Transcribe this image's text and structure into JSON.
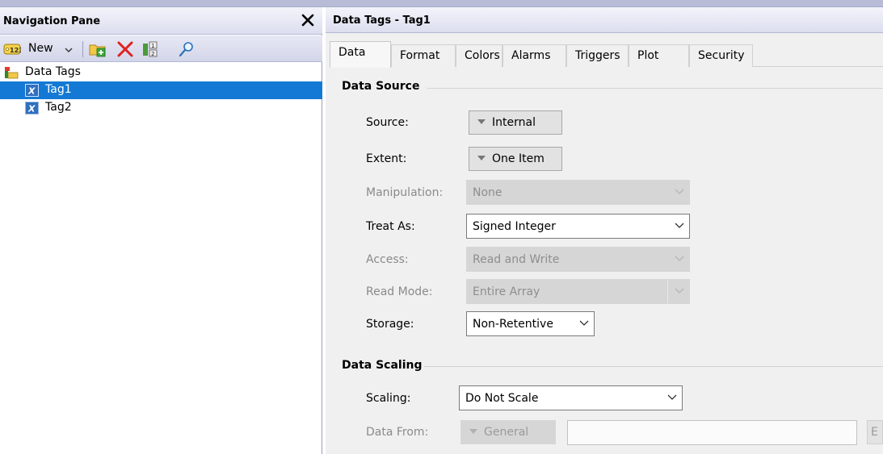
{
  "nav_pane": {
    "title": "Navigation Pane",
    "toolbar": {
      "new_label": "New",
      "icons": [
        "tag-123-icon",
        "dropdown-arrow-icon",
        "add-folder-icon",
        "delete-icon",
        "sort-icon",
        "search-icon"
      ]
    },
    "tree": {
      "root_label": "Data Tags",
      "items": [
        {
          "label": "Tag1",
          "selected": true
        },
        {
          "label": "Tag2",
          "selected": false
        }
      ]
    }
  },
  "panel": {
    "title": "Data Tags - Tag1",
    "tabs": [
      "Data",
      "Format",
      "Colors",
      "Alarms",
      "Triggers",
      "Plot",
      "Security"
    ],
    "active_tab": "Data",
    "data_source": {
      "section_title": "Data Source",
      "source": {
        "label": "Source:",
        "value": "Internal"
      },
      "extent": {
        "label": "Extent:",
        "value": "One Item"
      },
      "manipulation": {
        "label": "Manipulation:",
        "value": "None",
        "enabled": false
      },
      "treat_as": {
        "label": "Treat As:",
        "value": "Signed Integer"
      },
      "access": {
        "label": "Access:",
        "value": "Read and Write",
        "enabled": false
      },
      "read_mode": {
        "label": "Read Mode:",
        "value": "Entire Array",
        "enabled": false
      },
      "storage": {
        "label": "Storage:",
        "value": "Non-Retentive"
      }
    },
    "data_scaling": {
      "section_title": "Data Scaling",
      "scaling": {
        "label": "Scaling:",
        "value": "Do Not Scale"
      },
      "data_from": {
        "label": "Data From:",
        "value": "General",
        "enabled": false,
        "edit_button_partial": "E"
      }
    }
  },
  "colors": {
    "selection": "#1479d4",
    "delete_red": "#e02020",
    "header_bg": "#dcdeef"
  }
}
